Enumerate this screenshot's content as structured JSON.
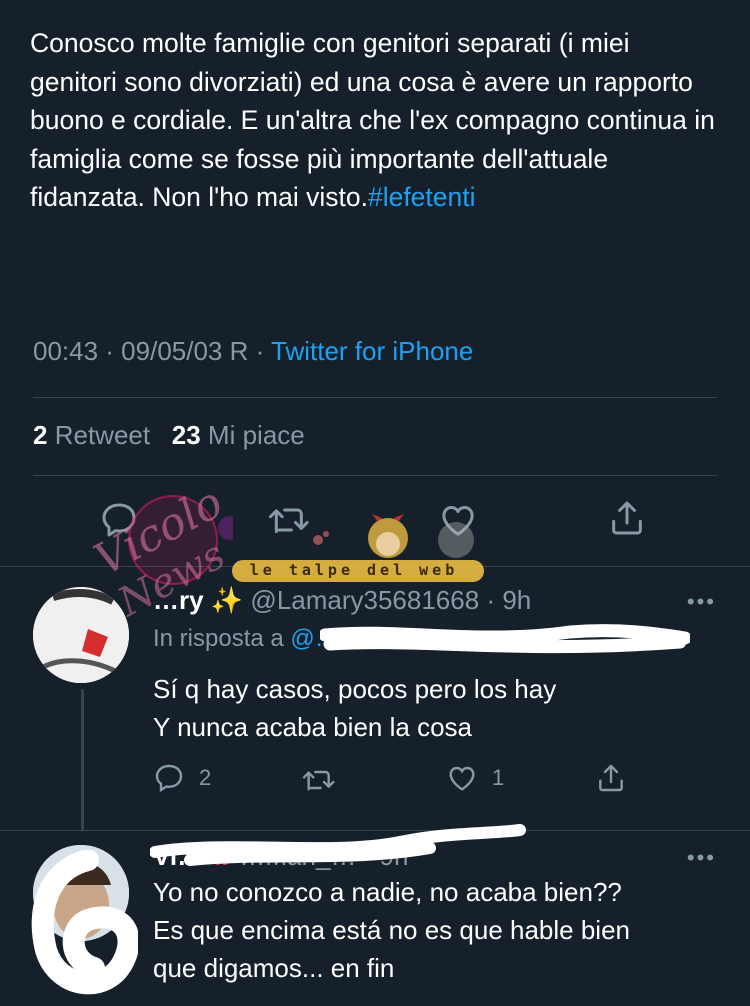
{
  "tweet": {
    "text_before_hashtag": "Conosco molte famiglie con genitori separati (i miei genitori sono divorziati) ed una cosa è avere un rapporto buono e cordiale. E un'altra che l'ex compagno continua in famiglia come se fosse più importante dell'attuale fidanzata. Non l'ho mai visto.",
    "hashtag": "#lefetenti",
    "time_date": "00:43 · 09/05/03 R · ",
    "source": "Twitter for iPhone",
    "retweets_count": "2",
    "retweets_label": "Retweet",
    "likes_count": "23",
    "likes_label": "Mi piace"
  },
  "watermarks": {
    "vicolo": "Vicolo delle News",
    "talpe": "le talpe del web"
  },
  "replies": [
    {
      "name": "…ry ✨",
      "handle": "@Lamary35681668",
      "time": "· 9h",
      "reply_to_label": "In risposta a ",
      "reply_to_mentions": "@…",
      "body_line1": "Sí q hay casos, pocos pero los hay",
      "body_line2": "Y nunca acaba bien la cosa",
      "reply_count": "2",
      "like_count": "1"
    },
    {
      "name": "Vi…",
      "handle": "…Man_…",
      "time": "· 9h",
      "body_line1": "Yo no conozco a nadie, no acaba bien??",
      "body_line2": "Es que encima está no es que hable bien",
      "body_line3": "que digamos... en fin"
    }
  ],
  "icons": {
    "reply": "reply-icon",
    "retweet": "retweet-icon",
    "like": "heart-icon",
    "share": "share-icon",
    "more": "more-icon"
  },
  "colors": {
    "background": "#15202b",
    "accent": "#1da1f2",
    "secondary_text": "#8899a6",
    "divider": "#38444d"
  }
}
